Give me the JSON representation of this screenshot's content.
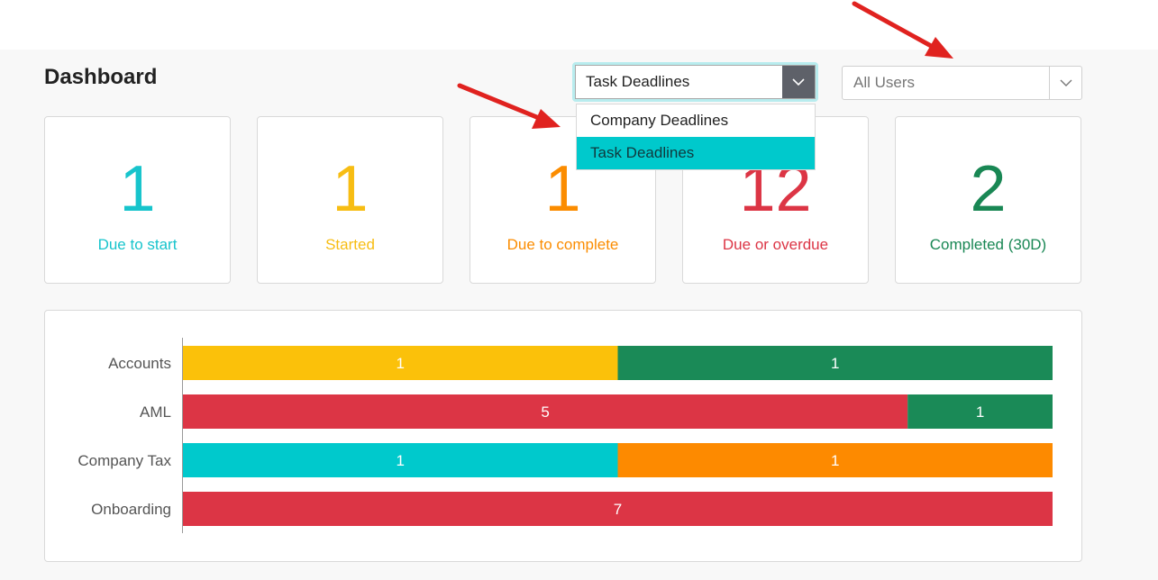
{
  "header": {
    "title": "Dashboard"
  },
  "deadline_select": {
    "value": "Task Deadlines",
    "options": [
      "Company Deadlines",
      "Task Deadlines"
    ],
    "selected_index": 1
  },
  "user_select": {
    "value": "All Users"
  },
  "cards": [
    {
      "value": "1",
      "label": "Due to start",
      "color": "#17c4cc"
    },
    {
      "value": "1",
      "label": "Started",
      "color": "#f7bd13"
    },
    {
      "value": "1",
      "label": "Due to complete",
      "color": "#fb8c00"
    },
    {
      "value": "12",
      "label": "Due or overdue",
      "color": "#dc3545"
    },
    {
      "value": "2",
      "label": "Completed (30D)",
      "color": "#198754"
    }
  ],
  "colors": {
    "due_to_start": "#00c9cc",
    "started": "#fbc10a",
    "due_to_complete": "#fd8a00",
    "overdue": "#dc3545",
    "completed": "#1a8a57",
    "arrow": "#e0221f"
  },
  "chart_data": {
    "type": "bar",
    "orientation": "horizontal",
    "stacked": true,
    "categories": [
      "Accounts",
      "AML",
      "Company Tax",
      "Onboarding"
    ],
    "series": [
      {
        "key": "due_to_start",
        "values": [
          0,
          0,
          1,
          0
        ]
      },
      {
        "key": "started",
        "values": [
          1,
          0,
          0,
          0
        ]
      },
      {
        "key": "due_to_complete",
        "values": [
          0,
          0,
          1,
          0
        ]
      },
      {
        "key": "overdue",
        "values": [
          0,
          5,
          0,
          7
        ]
      },
      {
        "key": "completed",
        "values": [
          1,
          1,
          0,
          0
        ]
      }
    ],
    "normalized": true,
    "grid": false,
    "legend": "none"
  }
}
